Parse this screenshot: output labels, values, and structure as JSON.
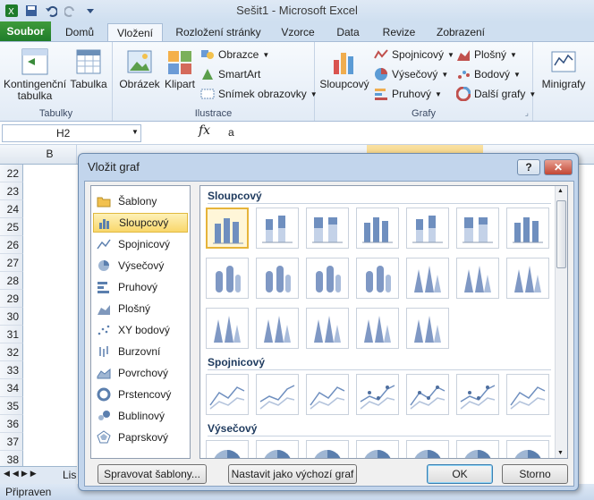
{
  "app": {
    "title": "Sešit1 - Microsoft Excel"
  },
  "tabs": [
    "Soubor",
    "Domů",
    "Vložení",
    "Rozložení stránky",
    "Vzorce",
    "Data",
    "Revize",
    "Zobrazení"
  ],
  "ribbon": {
    "tabulky": {
      "label": "Tabulky",
      "pivot": "Kontingenční tabulka",
      "table": "Tabulka"
    },
    "ilustrace": {
      "label": "Ilustrace",
      "picture": "Obrázek",
      "clipart": "Klipart",
      "shapes": "Obrazce",
      "smartart": "SmartArt",
      "screenshot": "Snímek obrazovky"
    },
    "grafy": {
      "label": "Grafy",
      "column": "Sloupcový",
      "line": "Spojnicový",
      "pie": "Výsečový",
      "bar": "Pruhový",
      "area": "Plošný",
      "scatter": "Bodový",
      "other": "Další grafy"
    },
    "minigrafy": {
      "label": "Minigrafy"
    }
  },
  "formula": {
    "cell": "H2",
    "fx": "fx",
    "value": "a"
  },
  "sheet": {
    "col_b": "B",
    "rows": [
      "22",
      "23",
      "24",
      "25",
      "26",
      "27",
      "28",
      "29",
      "30",
      "31",
      "32",
      "33",
      "34",
      "35",
      "36",
      "37",
      "38"
    ],
    "tab": "Lis",
    "status": "Připraven"
  },
  "dialog": {
    "title": "Vložit graf",
    "help": "?",
    "categories": [
      "Šablony",
      "Sloupcový",
      "Spojnicový",
      "Výsečový",
      "Pruhový",
      "Plošný",
      "XY bodový",
      "Burzovní",
      "Povrchový",
      "Prstencový",
      "Bublinový",
      "Paprskový"
    ],
    "selected_category": "Sloupcový",
    "sections": [
      "Sloupcový",
      "Spojnicový",
      "Výsečový"
    ],
    "buttons": {
      "manage": "Spravovat šablony...",
      "default": "Nastavit jako výchozí graf",
      "ok": "OK",
      "cancel": "Storno"
    }
  },
  "colors": {
    "file_tab": "#2a8a35",
    "selection": "#f9d76b",
    "dialog_frame": "#c2d5ec"
  }
}
